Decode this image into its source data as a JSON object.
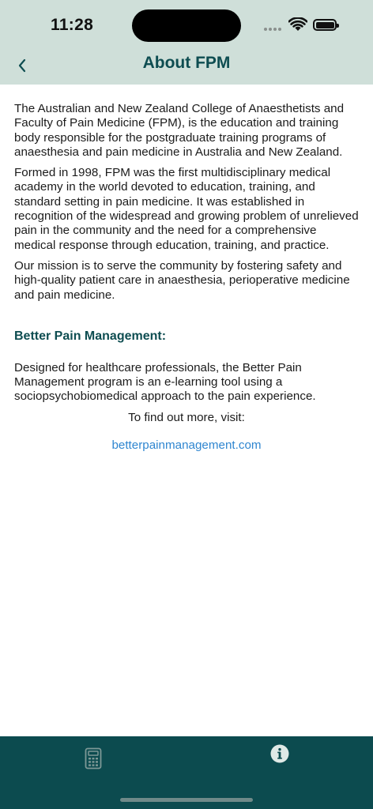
{
  "status_bar": {
    "time": "11:28"
  },
  "nav": {
    "title": "About FPM",
    "back_icon": "chevron-left-icon"
  },
  "content": {
    "paragraphs": [
      "The Australian and New Zealand College of Anaesthetists and Faculty of Pain Medicine (FPM), is the education and training body responsible for the postgraduate training programs of anaesthesia and pain medicine in Australia and New Zealand.",
      "Formed in 1998, FPM was the first multidisciplinary medical academy in the world devoted to education, training, and standard setting in pain medicine. It was established in recognition of the widespread and growing problem of unrelieved pain in the community and the need for a comprehensive medical response through education, training, and practice.",
      "Our mission is to serve the community by fostering safety and high-quality patient care in anaesthesia, perioperative medicine and pain medicine."
    ],
    "section_heading": "Better Pain Management:",
    "section_text": "Designed for healthcare professionals, the Better Pain Management program is an e-learning tool using a sociopsychobiomedical approach to the pain experience.",
    "find_out_more": "To find out more, visit:",
    "link_text": "betterpainmanagement.com"
  },
  "tabbar": {
    "tabs": [
      {
        "icon": "calculator-icon",
        "active": false
      },
      {
        "icon": "info-icon",
        "active": true
      }
    ]
  },
  "colors": {
    "header_bg": "#cfdfd9",
    "title": "#0e4d51",
    "tabbar_bg": "#0c4b4f",
    "link": "#2f86d0"
  }
}
